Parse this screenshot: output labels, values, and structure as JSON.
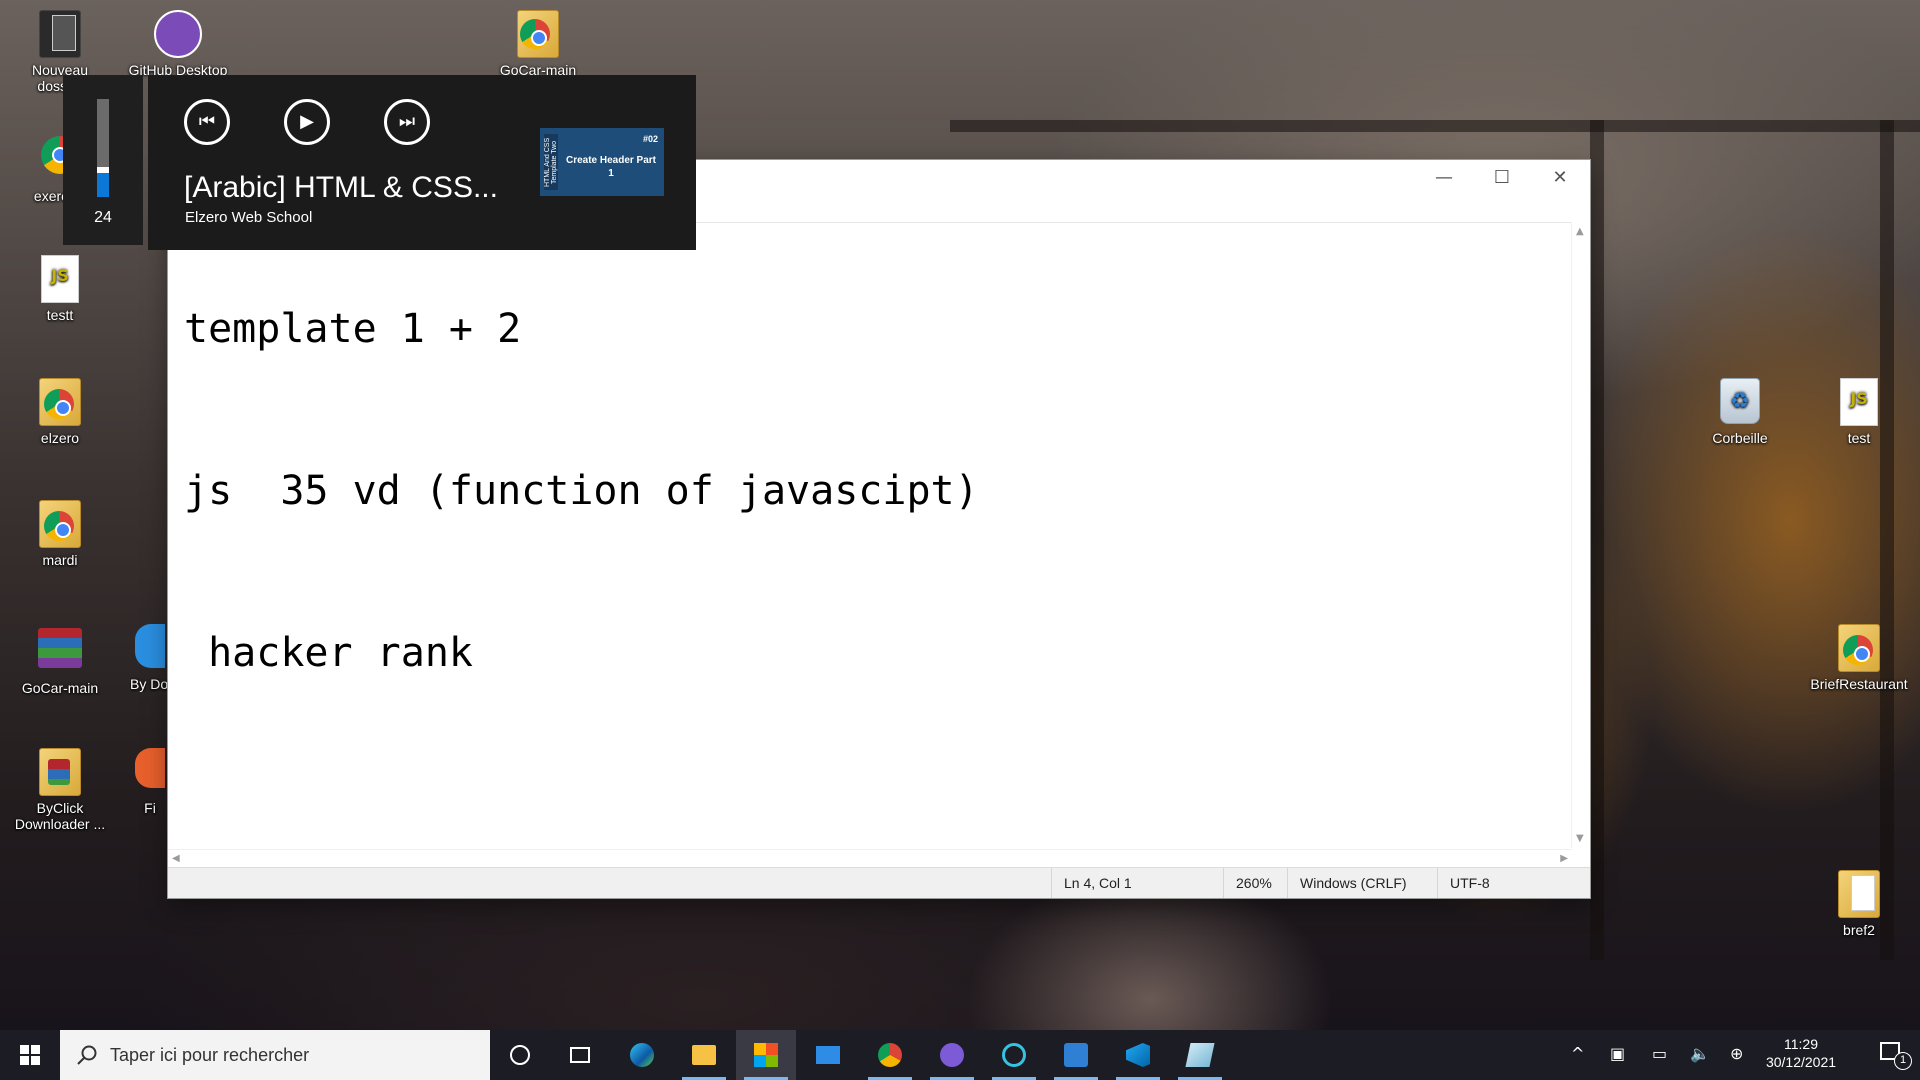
{
  "desktop": {
    "left_icons": [
      {
        "label": "Nouveau dossier"
      },
      {
        "label": "GitHub Desktop"
      },
      {
        "label": "exercice"
      },
      {
        "label": "testt"
      },
      {
        "label": "elzero"
      },
      {
        "label": "mardi"
      },
      {
        "label": "GoCar-main"
      },
      {
        "label": "ByClick Downloader ..."
      },
      {
        "label": "By Dow"
      },
      {
        "label": "Fi"
      },
      {
        "label": "GoCar-main"
      }
    ],
    "right_icons": [
      {
        "label": "Corbeille"
      },
      {
        "label": "test"
      },
      {
        "label": "BriefRestaurant"
      },
      {
        "label": "bref2"
      }
    ]
  },
  "media_overlay": {
    "volume": "24",
    "volume_level": 0.24,
    "title": "[Arabic] HTML & CSS...",
    "artist": "Elzero Web School",
    "thumbnail": {
      "number": "#02",
      "text": "Create Header Part 1",
      "side_text": "HTML And CSS Template Two"
    },
    "prev_icon": "skip-previous-icon",
    "play_icon": "play-icon",
    "next_icon": "skip-next-icon"
  },
  "notepad": {
    "window_controls": {
      "minimize": "—",
      "maximize": "☐",
      "close": "✕"
    },
    "lines": [
      "template 1 + 2",
      "js  35 vd (function of javascipt)",
      " hacker rank",
      ""
    ],
    "status": {
      "position": "Ln 4, Col 1",
      "zoom": "260%",
      "line_ending": "Windows (CRLF)",
      "encoding": "UTF-8"
    }
  },
  "taskbar": {
    "search_placeholder": "Taper ici pour rechercher",
    "time": "11:29",
    "date": "30/12/2021",
    "notification_count": "1",
    "apps": [
      "cortana-icon",
      "task-view-icon",
      "edge-icon",
      "file-explorer-icon",
      "store-icon",
      "mail-icon",
      "chrome-icon",
      "discord-icon",
      "app-icon",
      "settings-icon",
      "vscode-icon",
      "notepad-icon"
    ]
  },
  "colors": {
    "accent": "#0b78d7",
    "taskbar": "#1c1c24"
  }
}
